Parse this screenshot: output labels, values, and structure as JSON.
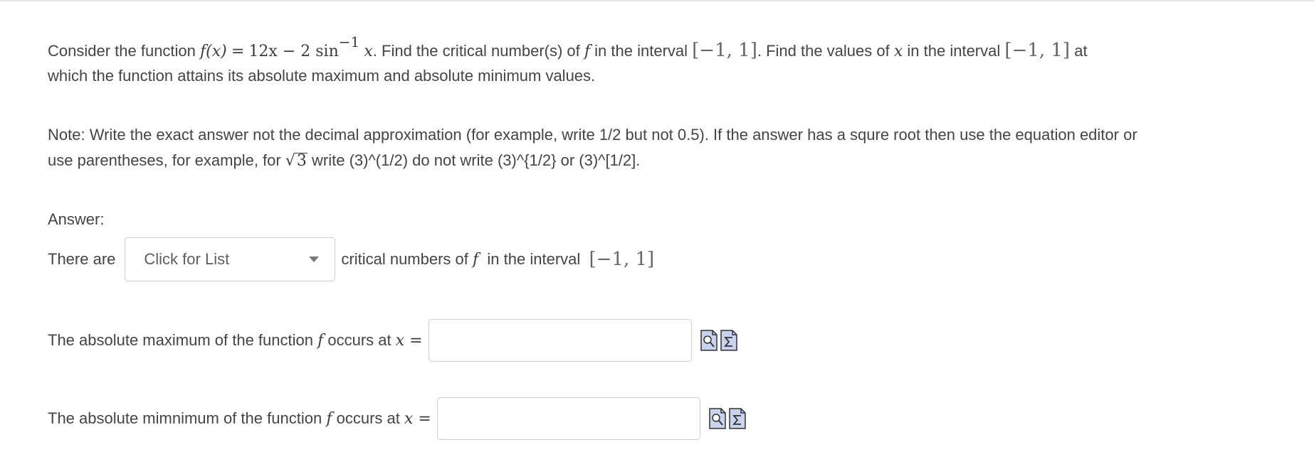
{
  "question": {
    "intro": "Consider the function",
    "func_lhs": "f(x)",
    "eq": "=",
    "func_rhs_a": "12x − 2 sin",
    "func_rhs_exp": "−1",
    "func_rhs_var": "x",
    "text_a": ". Find the critical number(s) of",
    "f_symbol": "f",
    "text_b": "in the interval",
    "interval": "[−1, 1]",
    "text_c": ". Find the values of",
    "x_symbol": "x",
    "text_d": "in the interval",
    "text_e": "at",
    "line2": "which the function attains its absolute maximum and absolute minimum values."
  },
  "note": {
    "line1": "Note: Write the exact answer not the decimal approximation (for example, write 1/2 but not 0.5). If the answer has a squre root then use the equation editor or",
    "line2_a": "use parentheses, for example, for",
    "sqrt_value": "3",
    "line2_b": "write (3)^(1/2) do not write (3)^{1/2} or (3)^[1/2]."
  },
  "answer": {
    "label": "Answer:",
    "critical_row": {
      "prefix": "There are",
      "select_placeholder": "Click for List",
      "suffix_a": "critical numbers of",
      "f_symbol": "f",
      "suffix_b": "in the interval",
      "interval": "[−1, 1]"
    },
    "max_row": {
      "text": "The absolute maximum of the function",
      "f_symbol": "f",
      "text_b": "occurs at",
      "x_eq": "x =",
      "value": ""
    },
    "min_row": {
      "text": "The absolute mimnimum of the function",
      "f_symbol": "f",
      "text_b": "occurs at",
      "x_eq": "x =",
      "value": ""
    }
  },
  "icons": {
    "preview": "preview-icon",
    "equation_editor": "equation-editor-icon"
  },
  "colors": {
    "text": "#444444",
    "border": "#cccccc",
    "icon_fill": "#c9d3ee",
    "icon_stroke": "#333333"
  }
}
